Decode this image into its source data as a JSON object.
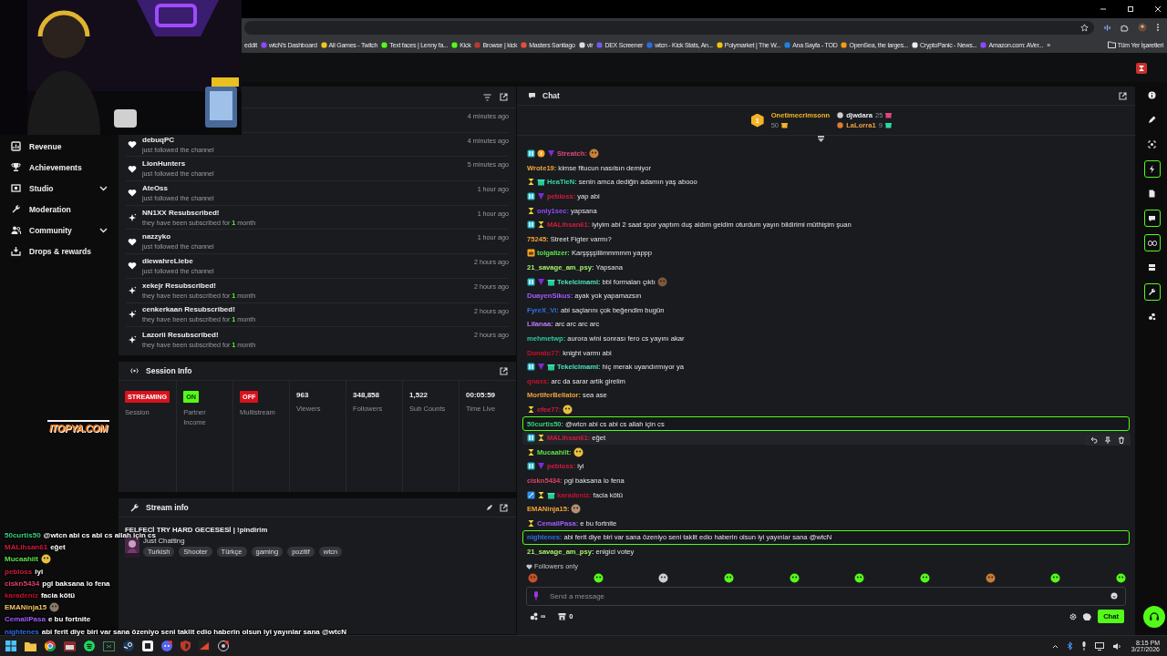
{
  "browser": {
    "bookmarks": [
      {
        "label": "eddit",
        "icon": false
      },
      {
        "label": "wtcN's Dashboard",
        "icon": true
      },
      {
        "label": "All Games - Twitch",
        "icon": true
      },
      {
        "label": "Text faces | Lenny fa...",
        "icon": true
      },
      {
        "label": "Kick",
        "icon": true
      },
      {
        "label": "Browse | kick",
        "icon": true
      },
      {
        "label": "Masters Santiago",
        "icon": true
      },
      {
        "label": "vlr",
        "icon": true
      },
      {
        "label": "DEX Screener",
        "icon": true
      },
      {
        "label": "wtcn - Kick Stats, An...",
        "icon": true
      },
      {
        "label": "Polymarket | The W...",
        "icon": true
      },
      {
        "label": "Ana Sayfa - TOD",
        "icon": true
      },
      {
        "label": "OpenSea, the larges...",
        "icon": true
      },
      {
        "label": "CryptoPanic - News...",
        "icon": true
      },
      {
        "label": "Amazon.com: AVer...",
        "icon": true
      }
    ],
    "more": "»",
    "all_bookmarks": "Tüm Yer İşaretleri"
  },
  "sidebar": {
    "items": [
      {
        "label": "Revenue",
        "kind": "revenue",
        "expandable": false
      },
      {
        "label": "Achievements",
        "kind": "trophy",
        "expandable": false
      },
      {
        "label": "Studio",
        "kind": "studio",
        "expandable": true
      },
      {
        "label": "Moderation",
        "kind": "wrench",
        "expandable": false
      },
      {
        "label": "Community",
        "kind": "people",
        "expandable": true
      },
      {
        "label": "Drops & rewards",
        "kind": "drops",
        "expandable": false
      }
    ]
  },
  "activity_feed": {
    "items": [
      {
        "time": "4 minutes ago"
      },
      {
        "kind": "follow",
        "name": "debuqPC",
        "detail": "just followed the channel",
        "time": "4 minutes ago"
      },
      {
        "kind": "follow",
        "name": "LionHunters",
        "detail": "just followed the channel",
        "time": "5 minutes ago"
      },
      {
        "kind": "follow",
        "name": "AteOss",
        "detail": "just followed the channel",
        "time": "1 hour ago"
      },
      {
        "kind": "resub",
        "name": "NN1XX Resubscribed!",
        "detail": "they have been subscribed for",
        "months": "1",
        "unit": "month",
        "time": "1 hour ago"
      },
      {
        "kind": "follow",
        "name": "nazzyko",
        "detail": "just followed the channel",
        "time": "1 hour ago"
      },
      {
        "kind": "follow",
        "name": "diewahreLiebe",
        "detail": "just followed the channel",
        "time": "2 hours ago"
      },
      {
        "kind": "resub",
        "name": "xekejr Resubscribed!",
        "detail": "they have been subscribed for",
        "months": "1",
        "unit": "month",
        "time": "2 hours ago"
      },
      {
        "kind": "resub",
        "name": "cenkerkaan Resubscribed!",
        "detail": "they have been subscribed for",
        "months": "1",
        "unit": "month",
        "time": "2 hours ago"
      },
      {
        "kind": "resub",
        "name": "Lazorii Resubscribed!",
        "detail": "they have been subscribed for",
        "months": "1",
        "unit": "month",
        "time": "2 hours ago"
      }
    ]
  },
  "session_info": {
    "title": "Session Info",
    "stats": [
      {
        "kind": "badge",
        "value": "STREAMING",
        "color": "#d6131c",
        "label": "Session"
      },
      {
        "kind": "badge",
        "value": "ON",
        "color": "#53fc18",
        "label": "Partner Income"
      },
      {
        "kind": "badge",
        "value": "OFF",
        "color": "#d6131c",
        "label": "Multistream"
      },
      {
        "kind": "number",
        "value": "963",
        "label": "Viewers"
      },
      {
        "kind": "number",
        "value": "348,858",
        "label": "Followers"
      },
      {
        "kind": "number",
        "value": "1,522",
        "label": "Sub Counts"
      },
      {
        "kind": "number",
        "value": "00:05:59",
        "label": "Time Live"
      }
    ]
  },
  "stream_info": {
    "title": "Stream info",
    "stream_title": "FELFECİ TRY HARD GECESESİ | !pindirim",
    "category": "Just Chatting",
    "tags": [
      "Turkish",
      "Shooter",
      "Türkçe",
      "gaming",
      "pozitif",
      "wtcn"
    ]
  },
  "chat": {
    "title": "Chat",
    "leaderboard": [
      {
        "rank": "1",
        "name": "Onetimecrimsonn",
        "count": "50"
      },
      {
        "name": "djwdara",
        "count": "25"
      },
      {
        "name": "LaLorra1",
        "count": "9"
      }
    ],
    "messages": [
      {
        "user": "Streatch:",
        "color": "#e0467a",
        "badges": [
          {
            "kind": "sub"
          },
          {
            "kind": "coin"
          },
          {
            "kind": "vip"
          }
        ],
        "emote": true,
        "highlighted": false,
        "hovered": false
      },
      {
        "user": "Wrote19:",
        "color": "#f2a33a",
        "text": "kimse fitucun nasılsın demiyor",
        "emote": false,
        "highlighted": false,
        "hovered": false
      },
      {
        "user": "HeaTieN:",
        "color": "#2ed8a8",
        "badges": [
          {
            "kind": "og"
          },
          {
            "kind": "gift"
          }
        ],
        "text": "senin amca dediğin adamın yaş abooo",
        "emote": false,
        "highlighted": false,
        "hovered": false
      },
      {
        "user": "pebloss:",
        "color": "#d41b3c",
        "badges": [
          {
            "kind": "sub"
          },
          {
            "kind": "vip"
          }
        ],
        "text": "yap abi",
        "emote": false,
        "highlighted": false,
        "hovered": false
      },
      {
        "user": "only1sec:",
        "color": "#8f4dff",
        "badges": [
          {
            "kind": "og"
          }
        ],
        "text": "yapsana",
        "emote": false,
        "highlighted": false,
        "hovered": false
      },
      {
        "user": "MALihsan61:",
        "color": "#d41b3c",
        "badges": [
          {
            "kind": "sub"
          },
          {
            "kind": "og"
          }
        ],
        "text": "iyiyim abi 2 saat spor yaptım duş aldım geldim oturdum yayın bildirimi müthişim şuan",
        "emote": false,
        "highlighted": false,
        "hovered": false
      },
      {
        "user": "75245:",
        "color": "#f2a33a",
        "text": "Street Figter varmı?",
        "emote": false,
        "highlighted": false,
        "hovered": false
      },
      {
        "user": "tolgalizer:",
        "color": "#5ee04a",
        "badges": [
          {
            "kind": "founder"
          }
        ],
        "text": "Karşşşşiiiimmmmm yappp",
        "emote": false,
        "highlighted": false,
        "hovered": false
      },
      {
        "user": "21_savage_am_psy:",
        "color": "#a6f06a",
        "text": "Yapsana",
        "emote": false,
        "highlighted": false,
        "hovered": false
      },
      {
        "user": "Tekelcimami:",
        "color": "#4fe0c0",
        "badges": [
          {
            "kind": "sub"
          },
          {
            "kind": "vip"
          },
          {
            "kind": "gift"
          }
        ],
        "text": "bbl formaları çıktı",
        "emote": true,
        "highlighted": false,
        "hovered": false
      },
      {
        "user": "DuayenSikus:",
        "color": "#a35cff",
        "text": "ayak yok yapamazsın",
        "emote": false,
        "highlighted": false,
        "hovered": false
      },
      {
        "user": "FyreX_Vi:",
        "color": "#2f6fe8",
        "text": "abi saçlarını çok beğendim bugün",
        "emote": false,
        "highlighted": false,
        "hovered": false
      },
      {
        "user": "Lilanaa:",
        "color": "#c07af7",
        "text": "arc arc arc arc",
        "emote": false,
        "highlighted": false,
        "hovered": false
      },
      {
        "user": "mehmetwp:",
        "color": "#2ec9a0",
        "text": "aurora wini sonrası fero cs yayını akar",
        "emote": false,
        "highlighted": false,
        "hovered": false
      },
      {
        "user": "Donato77:",
        "color": "#c8102e",
        "text": "knight varmı abi",
        "emote": false,
        "highlighted": false,
        "hovered": false
      },
      {
        "user": "Tekelcimami:",
        "color": "#4fe0c0",
        "badges": [
          {
            "kind": "sub"
          },
          {
            "kind": "vip"
          },
          {
            "kind": "gift"
          }
        ],
        "text": "hiç merak uyandırmıyor ya",
        "emote": false,
        "highlighted": false,
        "hovered": false
      },
      {
        "user": "qnaxs:",
        "color": "#c8102e",
        "text": "arc da sarar artik girelim",
        "emote": false,
        "highlighted": false,
        "hovered": false
      },
      {
        "user": "MortiferBellator:",
        "color": "#f2a33a",
        "text": "sea ase",
        "emote": false,
        "highlighted": false,
        "hovered": false
      },
      {
        "user": "efee77:",
        "color": "#d41b3c",
        "badges": [
          {
            "kind": "og"
          }
        ],
        "emote": true,
        "highlighted": false,
        "hovered": false
      },
      {
        "user": "50curtis50:",
        "color": "#38d17f",
        "text": "@wtcn abi cs abi cs allah için cs",
        "emote": false,
        "highlighted": true,
        "hovered": false
      },
      {
        "user": "MALihsan61:",
        "color": "#d41b3c",
        "badges": [
          {
            "kind": "sub"
          },
          {
            "kind": "og"
          }
        ],
        "text": "eğet",
        "emote": false,
        "highlighted": false,
        "hovered": true
      },
      {
        "user": "Mucaahiit:",
        "color": "#5ee04a",
        "badges": [
          {
            "kind": "og"
          }
        ],
        "emote": true,
        "highlighted": false,
        "hovered": false
      },
      {
        "user": "pebloss:",
        "color": "#d41b3c",
        "badges": [
          {
            "kind": "sub"
          },
          {
            "kind": "vip"
          }
        ],
        "text": "iyi",
        "emote": false,
        "highlighted": false,
        "hovered": false
      },
      {
        "user": "ciskn5434:",
        "color": "#e0406a",
        "text": "pgl baksana lo fena",
        "emote": false,
        "highlighted": false,
        "hovered": false
      },
      {
        "user": "karadeniz:",
        "color": "#c8102e",
        "badges": [
          {
            "kind": "mod"
          },
          {
            "kind": "og"
          },
          {
            "kind": "gift"
          }
        ],
        "text": "facia kötü",
        "emote": false,
        "highlighted": false,
        "hovered": false
      },
      {
        "user": "EMANinja15:",
        "color": "#f2a33a",
        "emote": true,
        "highlighted": false,
        "hovered": false
      },
      {
        "user": "CemaliPasa:",
        "color": "#a35cff",
        "badges": [
          {
            "kind": "og"
          }
        ],
        "text": "e bu fortnite",
        "emote": false,
        "highlighted": false,
        "hovered": false
      },
      {
        "user": "nightenes:",
        "color": "#2f6fe8",
        "text": "abi ferit diye biri var sana özeniyo seni taklit edio haberin olsun iyi yayınlar sana @wtcN",
        "emote": false,
        "highlighted": true,
        "hovered": false
      },
      {
        "user": "21_savage_am_psy:",
        "color": "#a6f06a",
        "text": "enigici votey",
        "emote": false,
        "highlighted": false,
        "hovered": false
      }
    ],
    "mode": "Followers only",
    "placeholder": "Send a message",
    "unlimited": "∞",
    "points": "0",
    "send": "Chat"
  },
  "right_rail": {
    "items": [
      {
        "kind": "info",
        "highlighted": false
      },
      {
        "kind": "edit",
        "highlighted": false
      },
      {
        "kind": "scan",
        "highlighted": false
      },
      {
        "kind": "bolt",
        "highlighted": true
      },
      {
        "kind": "notes",
        "highlighted": false
      },
      {
        "kind": "chat",
        "highlighted": true
      },
      {
        "kind": "link",
        "highlighted": true
      },
      {
        "kind": "layers",
        "highlighted": false
      },
      {
        "kind": "wrench",
        "highlighted": true
      },
      {
        "kind": "nodes",
        "highlighted": false
      }
    ]
  },
  "stream_overlay": {
    "sponsor": "ITOPYA.COM",
    "chat": [
      {
        "user": "50curtis50",
        "color": "#38d17f",
        "text": "@wtcn abi cs abi cs allah için cs",
        "emote": false
      },
      {
        "user": "MALihsan61",
        "color": "#d41b3c",
        "text": "eğet",
        "emote": false
      },
      {
        "user": "Mucaahiit",
        "color": "#5ee04a",
        "emote": true
      },
      {
        "user": "pebloss",
        "color": "#d41b3c",
        "text": "iyi",
        "emote": false
      },
      {
        "user": "ciskn5434",
        "color": "#e0406a",
        "text": "pgl baksana lo fena",
        "emote": false
      },
      {
        "user": "karadeniz",
        "color": "#c8102e",
        "text": "facia kötü",
        "emote": false
      },
      {
        "user": "EMANinja15",
        "color": "#f2c46a",
        "emote": true
      },
      {
        "user": "CemaliPasa",
        "color": "#a35cff",
        "text": "e bu fortnite",
        "emote": false
      },
      {
        "user": "nightenes",
        "color": "#2f6fe8",
        "text": "abi ferit diye biri var sana özeniyo seni taklit edio haberin olsun iyi yayınlar sana @wtcN",
        "emote": false
      }
    ]
  },
  "taskbar": {
    "time": "8:15 PM",
    "date": "3/27/2026"
  }
}
